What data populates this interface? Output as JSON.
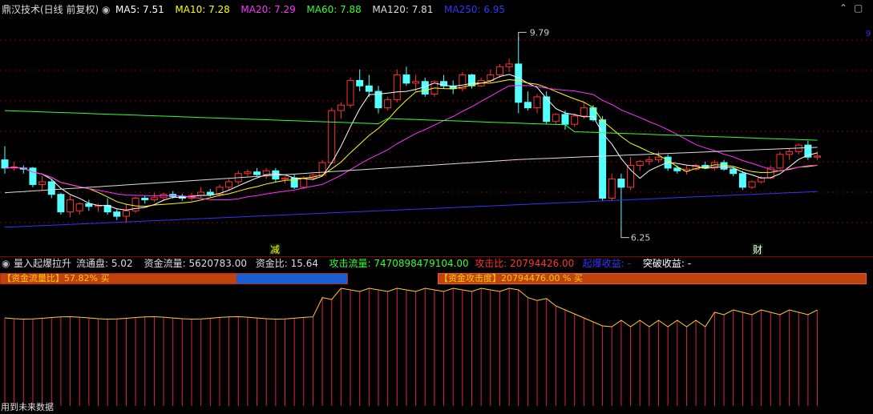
{
  "header": {
    "title": "鼎汉技术(日线 前复权)",
    "ma": [
      {
        "label": "MA5: 7.51",
        "color": "#ffffff"
      },
      {
        "label": "MA10: 7.28",
        "color": "#ffff00"
      },
      {
        "label": "MA20: 7.29",
        "color": "#ff33ff"
      },
      {
        "label": "MA60: 7.88",
        "color": "#33ff33"
      },
      {
        "label": "MA120: 7.81",
        "color": "#dddddd"
      },
      {
        "label": "MA250: 6.95",
        "color": "#3333ff"
      }
    ],
    "right_label": "9"
  },
  "price_chart": {
    "high_label": "9.79",
    "low_label": "6.25",
    "event_markers": [
      "减",
      "财"
    ],
    "colors": {
      "up": "#ff3232",
      "down": "#54ffff",
      "ma5": "#ffffff",
      "ma10": "#ffff00",
      "ma20": "#ff33ff",
      "ma60": "#33ff33",
      "ma120": "#dddddd",
      "ma250": "#3333ff",
      "grid": "#8b0000"
    }
  },
  "indicator": {
    "name": "量入起爆拉升",
    "items": [
      {
        "label": "流通盘: 5.02",
        "color": "#dddddd"
      },
      {
        "label": "资金流量: 5620783.00",
        "color": "#dddddd"
      },
      {
        "label": "资金比: 15.64",
        "color": "#dddddd"
      },
      {
        "label": "攻击流量: 7470898479104.00",
        "color": "#33ff33"
      },
      {
        "label": "攻击比: 20794426.00",
        "color": "#ff3232"
      },
      {
        "label": "起爆收益: -",
        "color": "#3333ff"
      },
      {
        "label": "突破收益: -",
        "color": "#ffffff"
      }
    ],
    "bar1": {
      "label": "【资金流量比】57.82% 买",
      "fill_percent": 57.82,
      "colors": {
        "red": "#c0420c",
        "blue": "#1a5fd1"
      }
    },
    "bar2": {
      "label": "【资金攻击度】20794476.00 % 买"
    },
    "line_color": "#ffcc33",
    "footer_note": "用到未来数据"
  },
  "chart_data": {
    "type": "bar",
    "categories": [],
    "candles_ohlc": [
      [
        7.55,
        7.8,
        7.3,
        7.4
      ],
      [
        7.4,
        7.52,
        7.35,
        7.42
      ],
      [
        7.4,
        7.45,
        7.3,
        7.38
      ],
      [
        7.4,
        7.42,
        7.05,
        7.1
      ],
      [
        7.1,
        7.25,
        7.0,
        7.15
      ],
      [
        7.15,
        7.2,
        6.85,
        6.92
      ],
      [
        6.92,
        6.95,
        6.55,
        6.6
      ],
      [
        6.6,
        6.9,
        6.5,
        6.82
      ],
      [
        6.62,
        6.78,
        6.55,
        6.75
      ],
      [
        6.75,
        6.82,
        6.62,
        6.7
      ],
      [
        6.7,
        6.75,
        6.6,
        6.72
      ],
      [
        6.72,
        6.85,
        6.55,
        6.6
      ],
      [
        6.6,
        6.65,
        6.45,
        6.52
      ],
      [
        6.52,
        6.75,
        6.4,
        6.62
      ],
      [
        6.62,
        6.88,
        6.58,
        6.85
      ],
      [
        6.85,
        6.9,
        6.75,
        6.82
      ],
      [
        6.82,
        6.95,
        6.78,
        6.86
      ],
      [
        6.86,
        6.95,
        6.8,
        6.92
      ],
      [
        6.92,
        6.98,
        6.84,
        6.88
      ],
      [
        6.88,
        6.93,
        6.8,
        6.85
      ],
      [
        6.85,
        6.95,
        6.8,
        6.9
      ],
      [
        6.9,
        7.05,
        6.86,
        6.96
      ],
      [
        6.96,
        7.02,
        6.88,
        6.92
      ],
      [
        6.92,
        7.1,
        6.88,
        7.05
      ],
      [
        7.05,
        7.2,
        7.0,
        7.15
      ],
      [
        7.15,
        7.35,
        7.1,
        7.3
      ],
      [
        7.3,
        7.38,
        7.25,
        7.33
      ],
      [
        7.33,
        7.4,
        7.25,
        7.28
      ],
      [
        7.28,
        7.4,
        7.2,
        7.35
      ],
      [
        7.35,
        7.4,
        7.15,
        7.2
      ],
      [
        7.2,
        7.25,
        7.12,
        7.22
      ],
      [
        7.22,
        7.28,
        7.02,
        7.05
      ],
      [
        7.05,
        7.25,
        7.02,
        7.22
      ],
      [
        7.22,
        7.3,
        7.18,
        7.27
      ],
      [
        7.27,
        7.55,
        7.25,
        7.5
      ],
      [
        7.5,
        8.5,
        7.48,
        8.45
      ],
      [
        8.45,
        8.6,
        8.3,
        8.55
      ],
      [
        8.55,
        9.05,
        8.5,
        9.0
      ],
      [
        9.0,
        9.2,
        8.8,
        8.9
      ],
      [
        8.9,
        9.1,
        8.7,
        8.8
      ],
      [
        8.8,
        8.9,
        8.4,
        8.5
      ],
      [
        8.5,
        8.7,
        8.45,
        8.65
      ],
      [
        8.65,
        9.2,
        8.6,
        9.1
      ],
      [
        9.1,
        9.25,
        8.9,
        8.95
      ],
      [
        8.95,
        9.1,
        8.8,
        8.98
      ],
      [
        8.98,
        9.05,
        8.7,
        8.75
      ],
      [
        8.75,
        9.0,
        8.7,
        8.98
      ],
      [
        8.98,
        9.1,
        8.85,
        8.9
      ],
      [
        8.9,
        9.0,
        8.75,
        8.85
      ],
      [
        8.85,
        9.15,
        8.8,
        9.1
      ],
      [
        9.1,
        9.12,
        8.85,
        8.9
      ],
      [
        8.9,
        9.05,
        8.88,
        9.0
      ],
      [
        9.0,
        9.2,
        8.95,
        9.1
      ],
      [
        9.1,
        9.3,
        9.05,
        9.25
      ],
      [
        9.25,
        9.4,
        9.15,
        9.3
      ],
      [
        9.3,
        9.79,
        8.4,
        8.6
      ],
      [
        8.6,
        8.8,
        8.45,
        8.5
      ],
      [
        8.5,
        8.75,
        8.4,
        8.7
      ],
      [
        8.7,
        8.8,
        8.2,
        8.25
      ],
      [
        8.25,
        8.4,
        8.2,
        8.38
      ],
      [
        8.38,
        8.45,
        8.1,
        8.2
      ],
      [
        8.2,
        8.4,
        8.15,
        8.35
      ],
      [
        8.35,
        8.6,
        8.3,
        8.5
      ],
      [
        8.5,
        8.55,
        8.25,
        8.28
      ],
      [
        8.28,
        8.35,
        6.8,
        6.85
      ],
      [
        6.85,
        7.3,
        6.8,
        7.2
      ],
      [
        7.2,
        7.3,
        6.25,
        7.05
      ],
      [
        7.05,
        7.6,
        7.0,
        7.45
      ],
      [
        7.45,
        7.55,
        7.35,
        7.52
      ],
      [
        7.52,
        7.62,
        7.45,
        7.55
      ],
      [
        7.55,
        7.7,
        7.5,
        7.6
      ],
      [
        7.6,
        7.65,
        7.35,
        7.4
      ],
      [
        7.4,
        7.45,
        7.3,
        7.35
      ],
      [
        7.35,
        7.45,
        7.28,
        7.38
      ],
      [
        7.38,
        7.48,
        7.35,
        7.45
      ],
      [
        7.45,
        7.52,
        7.38,
        7.4
      ],
      [
        7.4,
        7.55,
        7.36,
        7.5
      ],
      [
        7.5,
        7.55,
        7.35,
        7.38
      ],
      [
        7.38,
        7.42,
        7.25,
        7.3
      ],
      [
        7.3,
        7.35,
        7.0,
        7.05
      ],
      [
        7.05,
        7.18,
        7.02,
        7.15
      ],
      [
        7.15,
        7.25,
        7.12,
        7.22
      ],
      [
        7.22,
        7.45,
        7.2,
        7.4
      ],
      [
        7.4,
        7.7,
        7.38,
        7.65
      ],
      [
        7.65,
        7.75,
        7.55,
        7.7
      ],
      [
        7.7,
        7.85,
        7.65,
        7.82
      ],
      [
        7.82,
        7.9,
        7.55,
        7.6
      ],
      [
        7.6,
        7.7,
        7.55,
        7.62
      ]
    ],
    "ylim": [
      6.2,
      10.0
    ]
  }
}
